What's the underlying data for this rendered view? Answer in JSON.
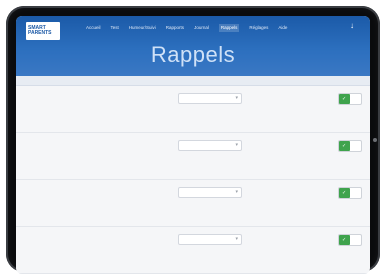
{
  "page": {
    "title": "Rappels",
    "background": "#ffffff",
    "device_color": "#0a0b0d"
  },
  "header": {
    "logo_line1": "SMART",
    "logo_line2": "PARENTS",
    "logo_sub": "",
    "nav": [
      {
        "label": "Accueil",
        "active": false
      },
      {
        "label": "Test",
        "active": false
      },
      {
        "label": "Humeur/Suivi",
        "active": false
      },
      {
        "label": "Rapports",
        "active": false
      },
      {
        "label": "Journal",
        "active": false
      },
      {
        "label": "Rappels",
        "active": true
      },
      {
        "label": "Réglages",
        "active": false
      },
      {
        "label": "Aide",
        "active": false
      }
    ],
    "download_icon": "download-icon",
    "accent": "#1b5aa8"
  },
  "subheader": {
    "left": "",
    "right": ""
  },
  "rows": [
    {
      "title": "",
      "desc": "",
      "select": "",
      "status": "",
      "on": true
    },
    {
      "title": "",
      "desc": "",
      "select": "",
      "status": "",
      "on": true
    },
    {
      "title": "",
      "desc": "",
      "select": "",
      "status": "",
      "on": true
    },
    {
      "title": "",
      "desc": "",
      "select": "",
      "status": "",
      "on": true
    }
  ],
  "colors": {
    "toggle_on": "#3fa34d"
  }
}
